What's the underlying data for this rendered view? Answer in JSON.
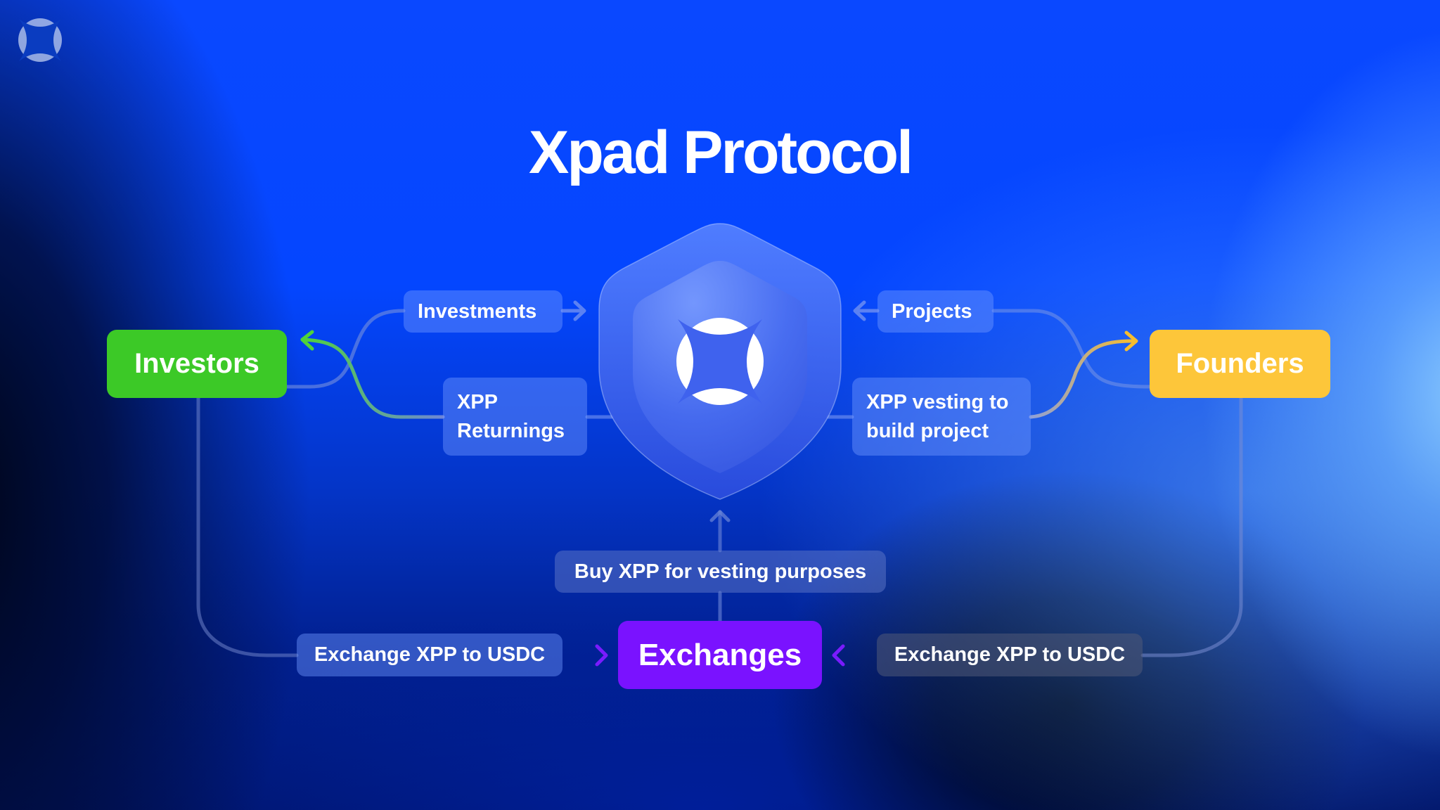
{
  "title": "Xpad Protocol",
  "brand_icon": "xpad-logo-icon",
  "nodes": {
    "investors": {
      "label": "Investors",
      "color": "#3CC927"
    },
    "founders": {
      "label": "Founders",
      "color": "#FDC63A"
    },
    "exchanges": {
      "label": "Exchanges",
      "color": "#7A12FF"
    },
    "protocol": {
      "icon": "shield-icon",
      "logo": "xpad-logo-icon"
    }
  },
  "flows": {
    "investments": "Investments",
    "xpp_returnings_line1": "XPP",
    "xpp_returnings_line2": "Returnings",
    "projects": "Projects",
    "xpp_vesting_line1": "XPP vesting to",
    "xpp_vesting_line2": "build project",
    "buy_xpp": "Buy XPP for vesting purposes",
    "exchange_left": "Exchange XPP to USDC",
    "exchange_right": "Exchange XPP to USDC"
  },
  "colors": {
    "connector": "#6f86d6",
    "green_arrow": "#4fd33a",
    "yellow_arrow": "#f7bd2e",
    "purple_arrow": "#7a1bff"
  }
}
